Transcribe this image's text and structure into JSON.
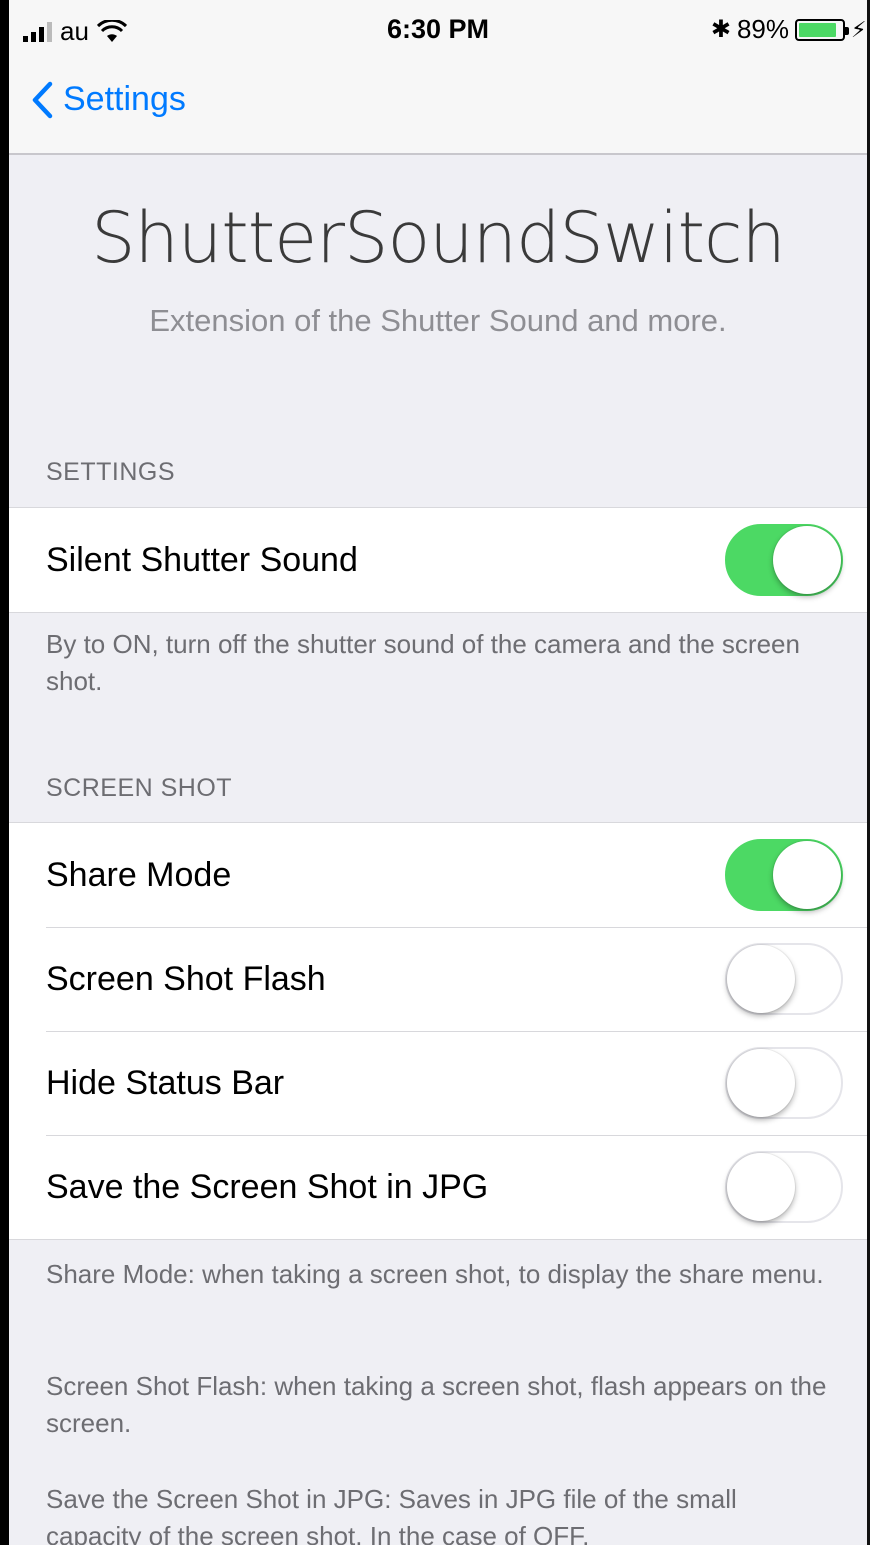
{
  "status_bar": {
    "carrier": "au",
    "time": "6:30 PM",
    "battery_percent": "89%",
    "battery_level": 0.89,
    "icons": [
      "signal-icon",
      "wifi-icon",
      "bluetooth-icon",
      "battery-icon",
      "charging-icon"
    ]
  },
  "nav": {
    "back_label": "Settings"
  },
  "header": {
    "title": "ShutterSoundSwitch",
    "subtitle": "Extension of the Shutter Sound and more."
  },
  "sections": [
    {
      "header": "SETTINGS",
      "rows": [
        {
          "label": "Silent Shutter Sound",
          "on": true
        }
      ],
      "footer": "By to ON, turn off the shutter sound of the camera and the screen shot."
    },
    {
      "header": "SCREEN SHOT",
      "rows": [
        {
          "label": "Share Mode",
          "on": true
        },
        {
          "label": "Screen Shot Flash",
          "on": false
        },
        {
          "label": "Hide Status Bar",
          "on": false
        },
        {
          "label": "Save the Screen Shot in JPG",
          "on": false
        }
      ],
      "footer_notes": [
        "Share Mode: when taking a screen shot, to display the share menu.",
        "Screen Shot Flash: when taking a screen shot, flash appears on the screen.",
        "Save the Screen Shot in JPG: Saves in JPG file of the small capacity of the screen shot. In the case of OFF,"
      ]
    }
  ],
  "colors": {
    "accent": "#007aff",
    "toggle_on": "#4cd964",
    "background": "#efeff4"
  }
}
